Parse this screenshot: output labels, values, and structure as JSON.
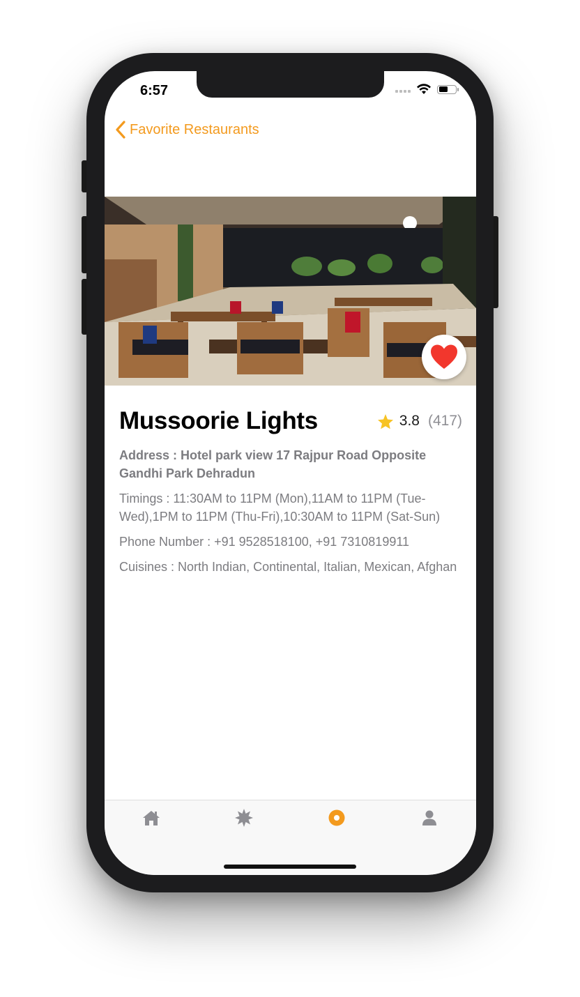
{
  "status_bar": {
    "time": "6:57"
  },
  "nav": {
    "back_label": "Favorite Restaurants"
  },
  "restaurant": {
    "name": "Mussoorie Lights",
    "rating": "3.8",
    "review_count": "(417)",
    "address": "Address : Hotel park view  17 Rajpur Road  Opposite Gandhi Park Dehradun",
    "timings": "Timings : 11:30AM to 11PM (Mon),11AM to 11PM (Tue-Wed),1PM to 11PM (Thu-Fri),10:30AM to 11PM (Sat-Sun)",
    "phone": "Phone Number : +91 9528518100, +91 7310819911",
    "cuisines": "Cuisines : North Indian, Continental, Italian, Mexican, Afghan",
    "is_favorite": true
  },
  "tab_bar": {
    "tabs": [
      {
        "icon": "home-icon",
        "active": false
      },
      {
        "icon": "starburst-icon",
        "active": false
      },
      {
        "icon": "favorites-circle-icon",
        "active": true
      },
      {
        "icon": "profile-icon",
        "active": false
      }
    ]
  },
  "colors": {
    "accent": "#f39a1e",
    "heart": "#f2372d",
    "star": "#f7c325",
    "secondary_text": "#7c7c80",
    "tab_inactive": "#8e8e93"
  }
}
